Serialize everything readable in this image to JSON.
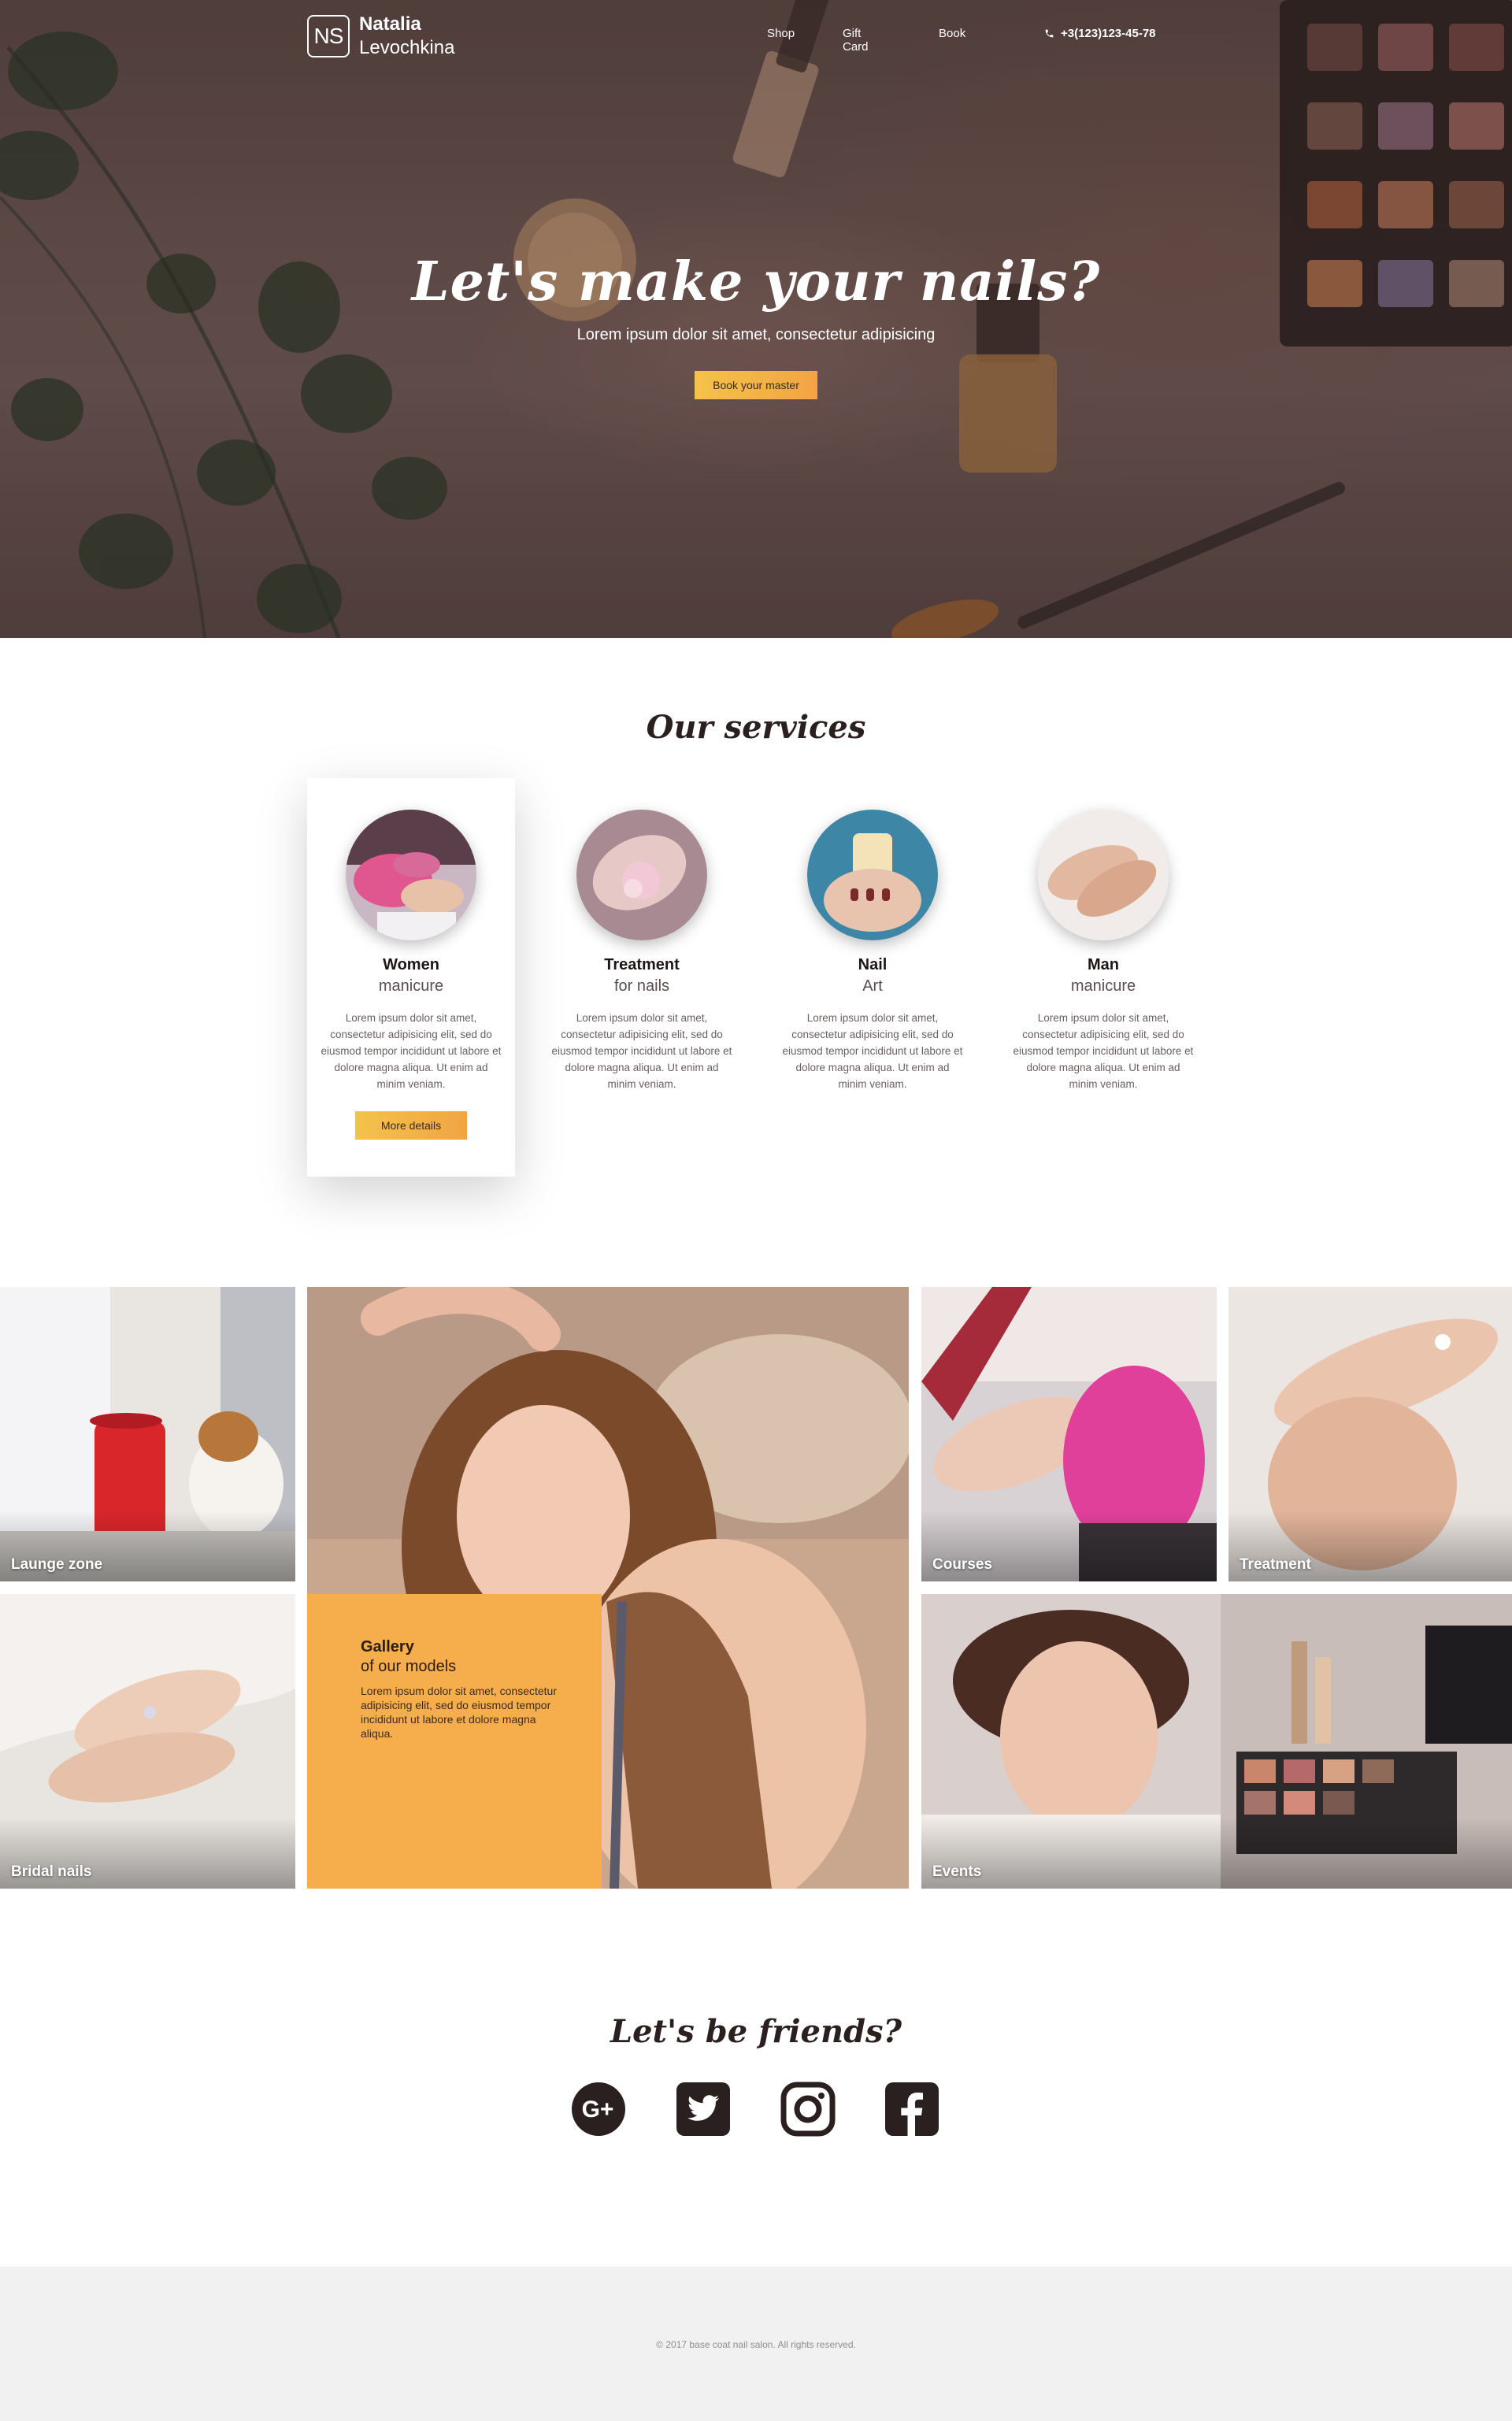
{
  "brand": {
    "mark": "NS",
    "first_name": "Natalia",
    "last_name": "Levochkina"
  },
  "nav": {
    "items": [
      "Shop",
      "Gift Card",
      "Book"
    ]
  },
  "contact": {
    "phone": "+3(123)123-45-78",
    "phone_icon": "phone-icon"
  },
  "hero": {
    "title": "Let's make your nails?",
    "subtitle": "Lorem ipsum dolor sit amet, consectetur adipisicing",
    "cta": "Book your master"
  },
  "services": {
    "title": "Our services",
    "items": [
      {
        "name": "Women",
        "sub": "manicure",
        "desc": "Lorem ipsum dolor sit amet, consectetur adipisicing elit, sed do eiusmod tempor incididunt ut labore et dolore magna aliqua. Ut enim ad minim veniam.",
        "button": "More details"
      },
      {
        "name": "Treatment",
        "sub": "for nails",
        "desc": "Lorem ipsum dolor sit amet, consectetur adipisicing elit, sed do eiusmod tempor incididunt ut labore et dolore magna aliqua. Ut enim ad minim veniam."
      },
      {
        "name": "Nail",
        "sub": "Art",
        "desc": "Lorem ipsum dolor sit amet, consectetur adipisicing elit, sed do eiusmod tempor incididunt ut labore et dolore magna aliqua. Ut enim ad minim veniam."
      },
      {
        "name": "Man",
        "sub": "manicure",
        "desc": "Lorem ipsum dolor sit amet, consectetur adipisicing elit, sed do eiusmod tempor incididunt ut labore et dolore magna aliqua. Ut enim ad minim veniam."
      }
    ]
  },
  "gallery": {
    "tiles": [
      "Launge zone",
      "Bridal nails",
      "Courses",
      "Treatment",
      "Events"
    ],
    "box": {
      "title": "Gallery",
      "subtitle": "of our models",
      "desc": "Lorem ipsum dolor sit amet, consectetur adipisicing elit, sed do eiusmod tempor incididunt ut labore et dolore magna aliqua."
    }
  },
  "social": {
    "title": "Let's be friends?",
    "icons": [
      "google-plus-icon",
      "twitter-icon",
      "instagram-icon",
      "facebook-icon"
    ]
  },
  "footer": {
    "copyright": "© 2017 base coat nail salon. All rights reserved."
  },
  "colors": {
    "accent": "#f6ae4c",
    "button_gradient_start": "#f3c34a",
    "button_gradient_end": "#f2a443",
    "dark": "#2a2020",
    "footer_bg": "#f1f1f1"
  }
}
